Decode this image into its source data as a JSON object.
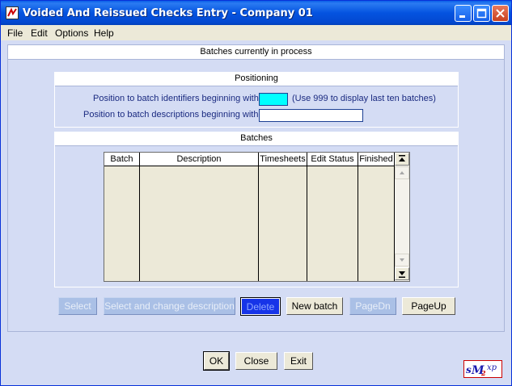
{
  "window": {
    "title": "Voided And Reissued Checks Entry - Company 01"
  },
  "menu": [
    "File",
    "Edit",
    "Options",
    "Help"
  ],
  "header": {
    "text": "Batches currently in process"
  },
  "positioning": {
    "heading": "Positioning",
    "batch_id_label": "Position to batch identifiers beginning with",
    "batch_id_value": "",
    "batch_id_hint": "(Use 999 to display last ten batches)",
    "desc_label": "Position to batch descriptions beginning with",
    "desc_value": ""
  },
  "batches": {
    "heading": "Batches",
    "columns": [
      "Batch",
      "Description",
      "Timesheets",
      "Edit Status",
      "Finished"
    ],
    "rows": []
  },
  "actions": {
    "select": "Select",
    "select_change": "Select and change description",
    "delete": "Delete",
    "new_batch": "New batch",
    "pagedn": "PageDn",
    "pageup": "PageUp"
  },
  "footer": {
    "ok": "OK",
    "close": "Close",
    "exit": "Exit"
  },
  "colors": {
    "background": "#D4DCF4",
    "titlebar": "#0453E0",
    "input_highlight": "#00FFFF",
    "delete_button": "#1634E8"
  },
  "icons": {
    "app": "app-icon",
    "minimize": "minimize-icon",
    "maximize": "maximize-icon",
    "close": "close-icon",
    "logo": "smz-logo"
  }
}
